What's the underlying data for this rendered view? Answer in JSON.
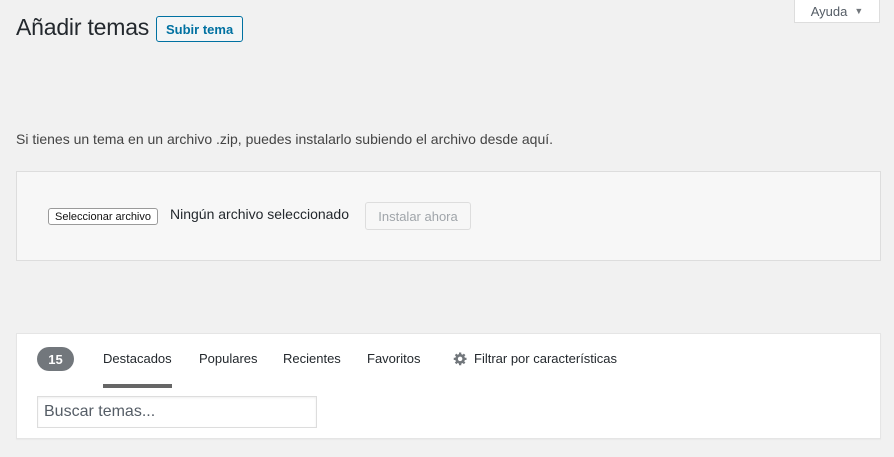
{
  "help": {
    "label": "Ayuda",
    "caret_icon": "triangle-down-icon"
  },
  "header": {
    "title": "Añadir temas",
    "upload_label": "Subir tema"
  },
  "upload": {
    "intro": "Si tienes un tema en un archivo .zip, puedes instalarlo subiendo el archivo desde aquí.",
    "choose_file_label": "Seleccionar archivo",
    "no_file_text": "Ningún archivo seleccionado",
    "install_label": "Instalar ahora"
  },
  "filter": {
    "count": "15",
    "tabs": [
      {
        "label": "Destacados",
        "active": true
      },
      {
        "label": "Populares",
        "active": false
      },
      {
        "label": "Recientes",
        "active": false
      },
      {
        "label": "Favoritos",
        "active": false
      }
    ],
    "feature_filter_label": "Filtrar por características",
    "feature_filter_icon": "gear-icon",
    "search_placeholder": "Buscar temas..."
  },
  "colors": {
    "background": "#f1f1f1",
    "accent": "#0071a1",
    "badge": "#72777c",
    "active_tab_underline": "#666666"
  }
}
